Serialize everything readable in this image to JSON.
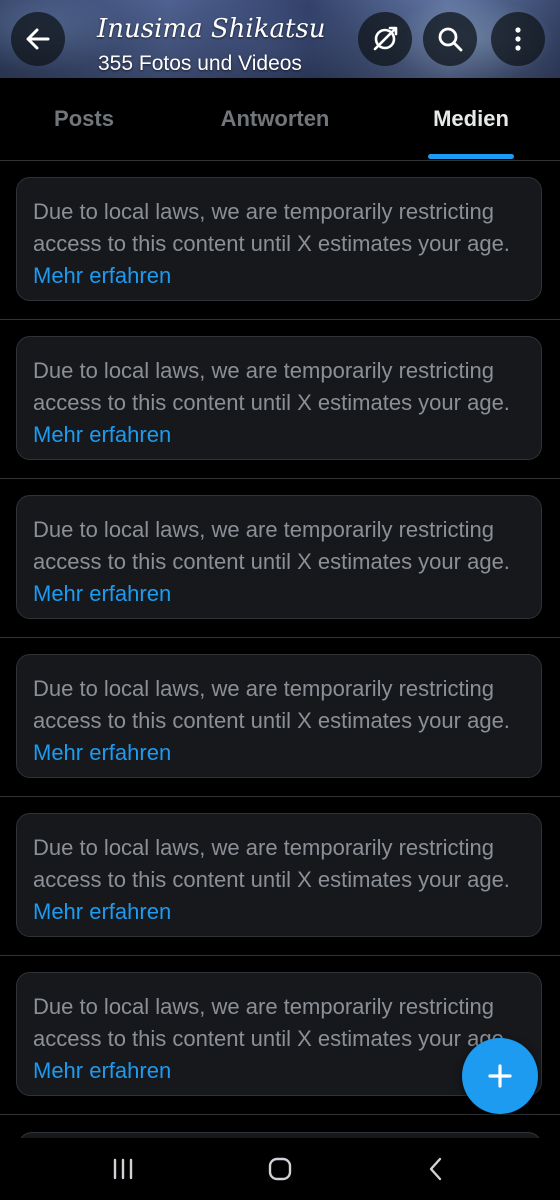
{
  "header": {
    "profile_name": "Inusima Shikatsu",
    "media_count": "355 Fotos und Videos",
    "icons": {
      "back": "arrow-left-icon",
      "sync": "sync-off-icon",
      "search": "search-icon",
      "more": "more-vertical-icon"
    }
  },
  "tabs": [
    {
      "label": "Posts",
      "selected": false
    },
    {
      "label": "Antworten",
      "selected": false
    },
    {
      "label": "Medien",
      "selected": true
    }
  ],
  "feed": {
    "items": [
      {
        "notice": "Due to local laws, we are temporarily restricting access to this content until X estimates your age.",
        "link": "Mehr erfahren"
      },
      {
        "notice": "Due to local laws, we are temporarily restricting access to this content until X estimates your age.",
        "link": "Mehr erfahren"
      },
      {
        "notice": "Due to local laws, we are temporarily restricting access to this content until X estimates your age.",
        "link": "Mehr erfahren"
      },
      {
        "notice": "Due to local laws, we are temporarily restricting access to this content until X estimates your age.",
        "link": "Mehr erfahren"
      },
      {
        "notice": "Due to local laws, we are temporarily restricting access to this content until X estimates your age.",
        "link": "Mehr erfahren"
      },
      {
        "notice": "Due to local laws, we are temporarily restricting access to this content until X estimates your age.",
        "link": "Mehr erfahren"
      }
    ]
  },
  "fab": {
    "icon": "plus-icon"
  },
  "system_nav": {
    "recents_icon": "recents-icon",
    "home_icon": "home-icon",
    "back_icon": "chevron-left-icon"
  },
  "colors": {
    "background": "#000000",
    "card": "#16181c",
    "border": "#2f3336",
    "accent": "#1d9bf0",
    "muted_text": "#8b9096",
    "tab_inactive": "#71767b",
    "tab_active": "#e7e9ea"
  }
}
